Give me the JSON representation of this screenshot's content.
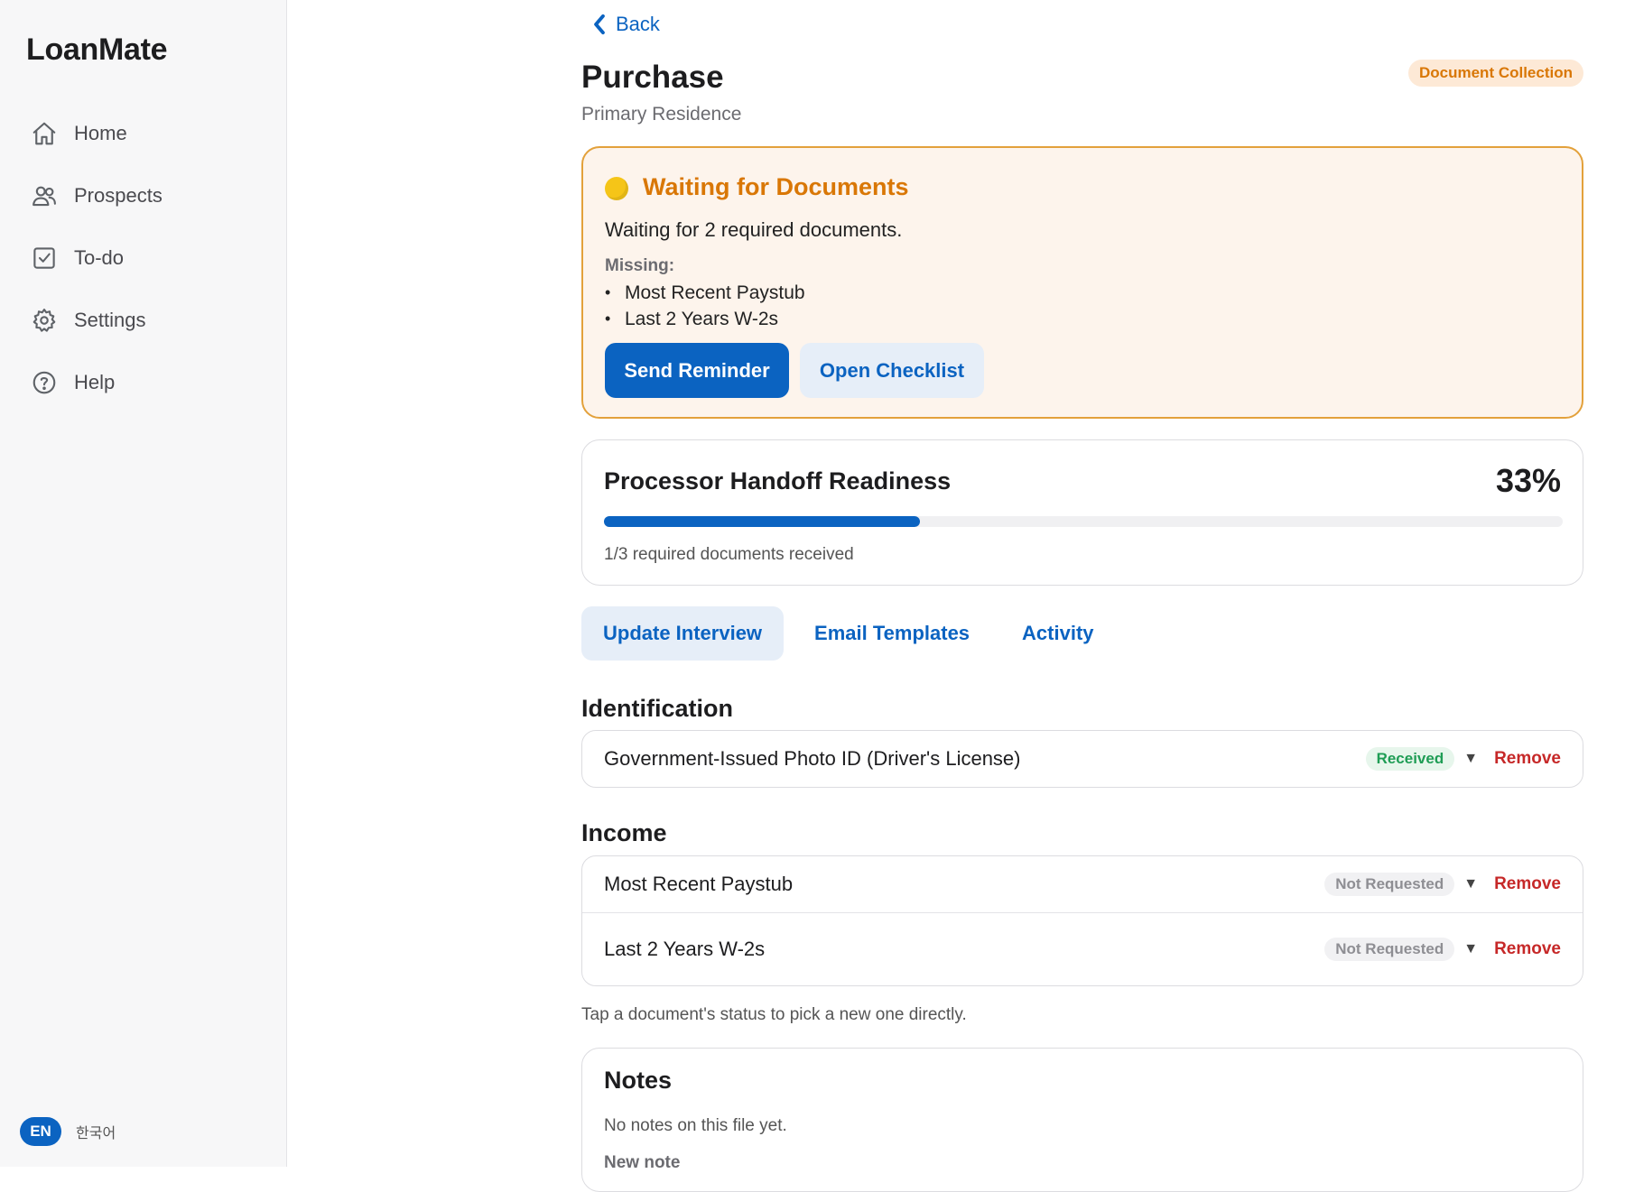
{
  "app": {
    "brand": "LoanMate"
  },
  "sidebar": {
    "items": [
      {
        "label": "Home",
        "icon": "home-icon"
      },
      {
        "label": "Prospects",
        "icon": "users-icon"
      },
      {
        "label": "To-do",
        "icon": "checkbox-icon"
      },
      {
        "label": "Settings",
        "icon": "gear-icon"
      },
      {
        "label": "Help",
        "icon": "help-icon"
      }
    ],
    "language": {
      "active": "EN",
      "alternate": "한국어"
    }
  },
  "header": {
    "back_label": "Back",
    "title": "Purchase",
    "subtitle": "Primary Residence",
    "stage_badge": "Document Collection"
  },
  "alert": {
    "title": "Waiting for Documents",
    "message": "Waiting for 2 required documents.",
    "missing_label": "Missing:",
    "missing_items": [
      "Most Recent Paystub",
      "Last 2 Years W-2s"
    ],
    "primary_button": "Send Reminder",
    "secondary_button": "Open Checklist"
  },
  "readiness": {
    "title": "Processor Handoff Readiness",
    "percent_label": "33%",
    "progress_fraction": 0.33,
    "note": "1/3 required documents received"
  },
  "tabs": [
    {
      "label": "Update Interview",
      "active": true
    },
    {
      "label": "Email Templates",
      "active": false
    },
    {
      "label": "Activity",
      "active": false
    }
  ],
  "sections": [
    {
      "title": "Identification",
      "documents": [
        {
          "name": "Government-Issued Photo ID (Driver's License)",
          "status": "Received",
          "caret": "▼",
          "remove": "Remove"
        }
      ]
    },
    {
      "title": "Income",
      "documents": [
        {
          "name": "Most Recent Paystub",
          "status": "Not Requested",
          "caret": "▼",
          "remove": "Remove"
        },
        {
          "name": "Last 2 Years W-2s",
          "status": "Not Requested",
          "caret": "▼",
          "remove": "Remove"
        }
      ]
    }
  ],
  "hint": "Tap a document's status to pick a new one directly.",
  "notes": {
    "title": "Notes",
    "empty_text": "No notes on this file yet.",
    "new_note_label": "New note"
  },
  "colors": {
    "accent": "#0b63c1",
    "warning": "#d97706",
    "received": "#1f9d55",
    "remove": "#c62828"
  }
}
